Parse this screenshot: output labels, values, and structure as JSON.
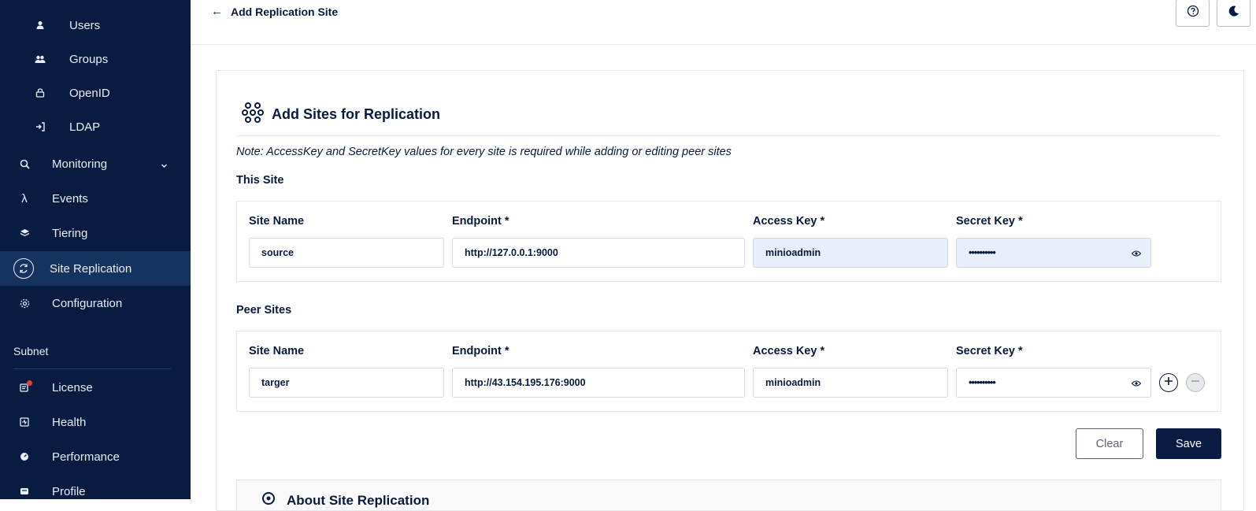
{
  "sidebar": {
    "items": [
      {
        "label": "Users",
        "icon": "user-icon"
      },
      {
        "label": "Groups",
        "icon": "groups-icon"
      },
      {
        "label": "OpenID",
        "icon": "openid-lock-icon"
      },
      {
        "label": "LDAP",
        "icon": "login-arrow-icon"
      },
      {
        "label": "Monitoring",
        "icon": "magnifier-icon"
      },
      {
        "label": "Events",
        "icon": "lambda-icon"
      },
      {
        "label": "Tiering",
        "icon": "layers-icon"
      },
      {
        "label": "Site Replication",
        "icon": "replication-icon"
      },
      {
        "label": "Configuration",
        "icon": "gear-icon"
      }
    ],
    "subnet_title": "Subnet",
    "subnet_items": [
      {
        "label": "License",
        "icon": "license-icon"
      },
      {
        "label": "Health",
        "icon": "health-icon"
      },
      {
        "label": "Performance",
        "icon": "performance-icon"
      },
      {
        "label": "Profile",
        "icon": "profile-icon"
      }
    ]
  },
  "header": {
    "back_label": "Add Replication Site",
    "back_arrow": "←"
  },
  "card": {
    "title": "Add Sites for Replication",
    "note": "Note: AccessKey and SecretKey values for every site is required while adding or editing peer sites",
    "labels": {
      "site_name": "Site Name",
      "endpoint": "Endpoint *",
      "access_key": "Access Key *",
      "secret_key": "Secret Key *"
    },
    "this_site": {
      "heading": "This Site",
      "site_name": "source",
      "endpoint": "http://127.0.0.1:9000",
      "access_key": "minioadmin",
      "secret_key": "••••••••••"
    },
    "peer_sites": {
      "heading": "Peer Sites",
      "site_name": "targer",
      "endpoint": "http://43.154.195.176:9000",
      "access_key": "minioadmin",
      "secret_key": "••••••••••"
    },
    "buttons": {
      "clear": "Clear",
      "save": "Save"
    },
    "about_title": "About Site Replication"
  },
  "colors": {
    "sidebar_bg": "#081c42",
    "sidebar_active": "#16335f",
    "text_primary": "#07193e",
    "autofill_bg": "#e8effb",
    "save_bg": "#081c42"
  }
}
